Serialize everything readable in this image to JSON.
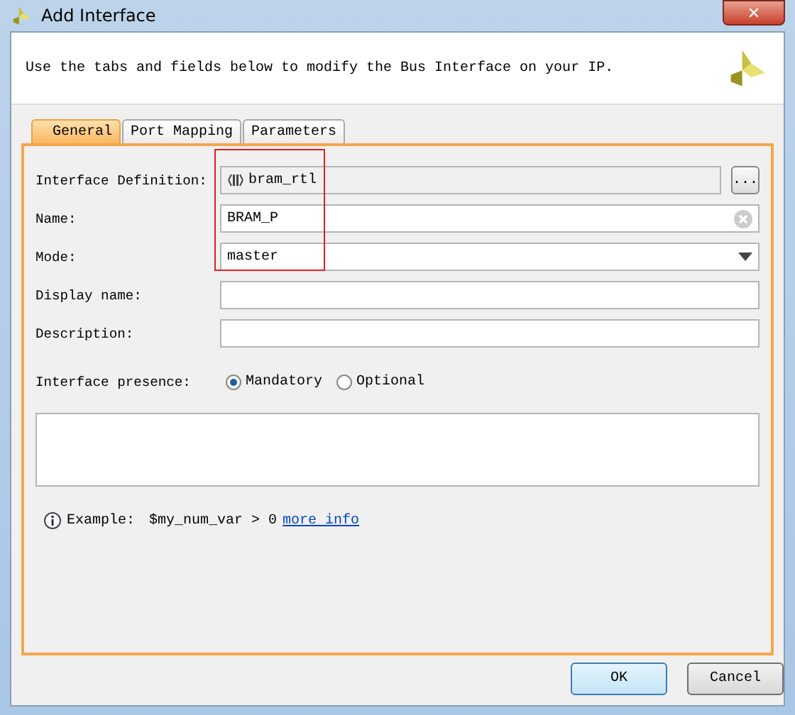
{
  "window": {
    "title": "Add Interface",
    "close": "✕"
  },
  "description": "Use the tabs and fields below to modify the Bus Interface on your IP.",
  "tabs": [
    {
      "label": "General",
      "selected": true
    },
    {
      "label": "Port Mapping",
      "selected": false
    },
    {
      "label": "Parameters",
      "selected": false
    }
  ],
  "fields": [
    {
      "kind": "readonly",
      "label": "Interface Definition:",
      "value": "bram_rtl",
      "button": "..."
    },
    {
      "kind": "clearable",
      "label": "Name:",
      "value": "BRAM_P"
    },
    {
      "kind": "dropdown",
      "label": "Mode:",
      "value": "master"
    },
    {
      "kind": "text",
      "label": "Display name:"
    },
    {
      "kind": "text",
      "label": "Description:"
    }
  ],
  "presence": {
    "label": "Interface presence:",
    "options": [
      {
        "label": "Mandatory",
        "selected": true
      },
      {
        "label": "Optional",
        "selected": false
      }
    ]
  },
  "example": {
    "label": "Example:",
    "expression": "$my_num_var > 0",
    "link": "more info"
  },
  "buttons": [
    {
      "label": "OK",
      "default": true
    },
    {
      "label": "Cancel",
      "default": false
    }
  ]
}
